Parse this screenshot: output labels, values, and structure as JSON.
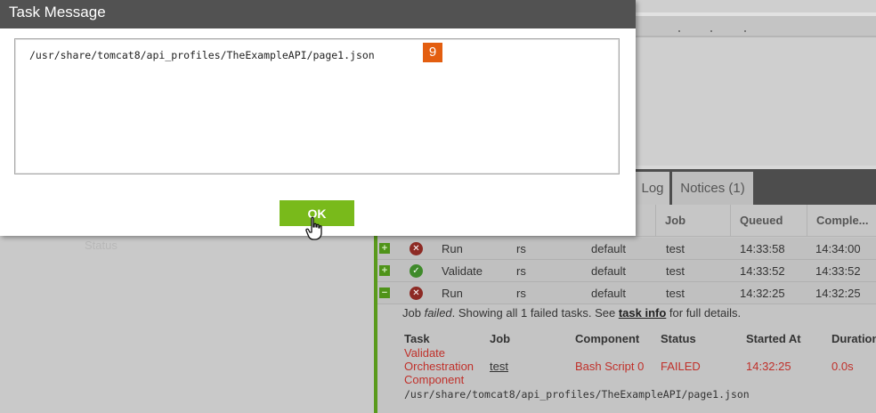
{
  "background": {
    "left_status_label": "Status",
    "tabs": {
      "log": "Log",
      "notices": "Notices (1)"
    },
    "table": {
      "headers": {
        "job": "Job",
        "queued": "Queued",
        "completed": "Comple..."
      },
      "rows": [
        {
          "expander": "+",
          "status": "failed",
          "task": "Run",
          "user": "rs",
          "env": "default",
          "job": "test",
          "queued": "14:33:58",
          "completed": "14:34:00"
        },
        {
          "expander": "+",
          "status": "success",
          "task": "Validate",
          "user": "rs",
          "env": "default",
          "job": "test",
          "queued": "14:33:52",
          "completed": "14:33:52"
        },
        {
          "expander": "−",
          "status": "failed",
          "task": "Run",
          "user": "rs",
          "env": "default",
          "job": "test",
          "queued": "14:32:25",
          "completed": "14:32:25"
        }
      ]
    },
    "detail": {
      "prefix": "Job ",
      "failed_word": "failed",
      "middle": ". Showing all 1 failed tasks. See ",
      "link_text": "task info",
      "suffix": " for full details.",
      "headers": {
        "task": "Task",
        "job": "Job",
        "component": "Component",
        "status": "Status",
        "started": "Started At",
        "duration": "Duration"
      },
      "row": {
        "task_line1": "Validate",
        "task_line2": "Orchestration",
        "task_line3": "Component",
        "job": "test",
        "component": "Bash Script 0",
        "status": "FAILED",
        "started": "14:32:25",
        "duration": "0.0s"
      },
      "path": "/usr/share/tomcat8/api_profiles/TheExampleAPI/page1.json"
    }
  },
  "modal": {
    "title": "Task Message",
    "message": "/usr/share/tomcat8/api_profiles/TheExampleAPI/page1.json",
    "badge": "9",
    "ok_label": "OK"
  },
  "colors": {
    "modal_title_bg": "#525252",
    "ok_button": "#79ba1b",
    "badge": "#e35e10",
    "failed_text": "#c0302a",
    "accent_green": "#5a9a1c"
  }
}
